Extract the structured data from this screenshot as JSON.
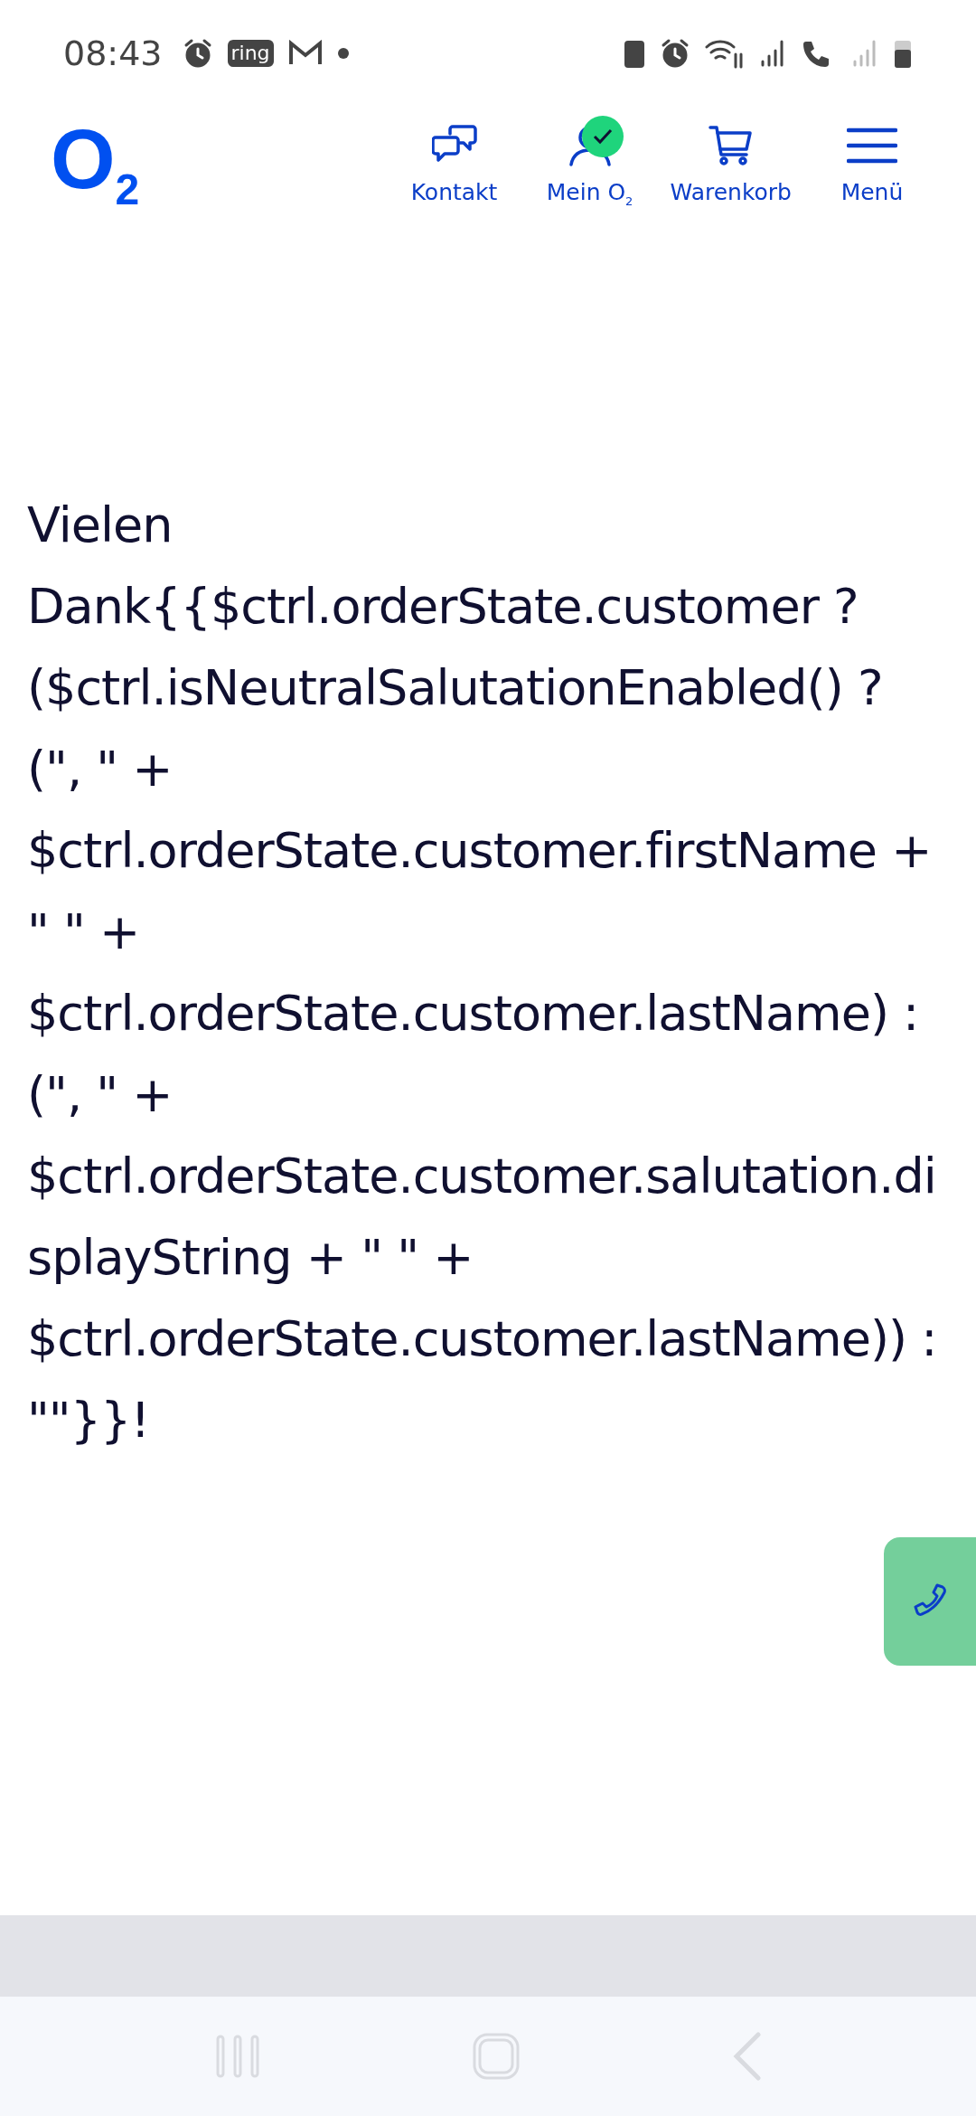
{
  "status_bar": {
    "time": "08:43",
    "app_badge": "ring"
  },
  "header": {
    "logo": "O$_{2}$",
    "nav": [
      {
        "kind": "chat",
        "label": "Kontakt",
        "checked": false
      },
      {
        "kind": "user",
        "label": "Mein O$_{2}$",
        "checked": true
      },
      {
        "kind": "cart",
        "label": "Warenkorb",
        "checked": false
      },
      {
        "kind": "menu",
        "label": "Menü",
        "checked": false
      }
    ]
  },
  "message": "Vielen Dank{{$ctrl.orderState.customer ? ($ctrl.isNeutralSalutationEnabled() ? (\", \" + $ctrl.orderState.customer.firstName + \" \" + $ctrl.orderState.customer.lastName) : (\", \" + $ctrl.orderState.customer.salutation.displayString + \" \" + $ctrl.orderState.customer.lastName)) : \"\"}}!"
}
